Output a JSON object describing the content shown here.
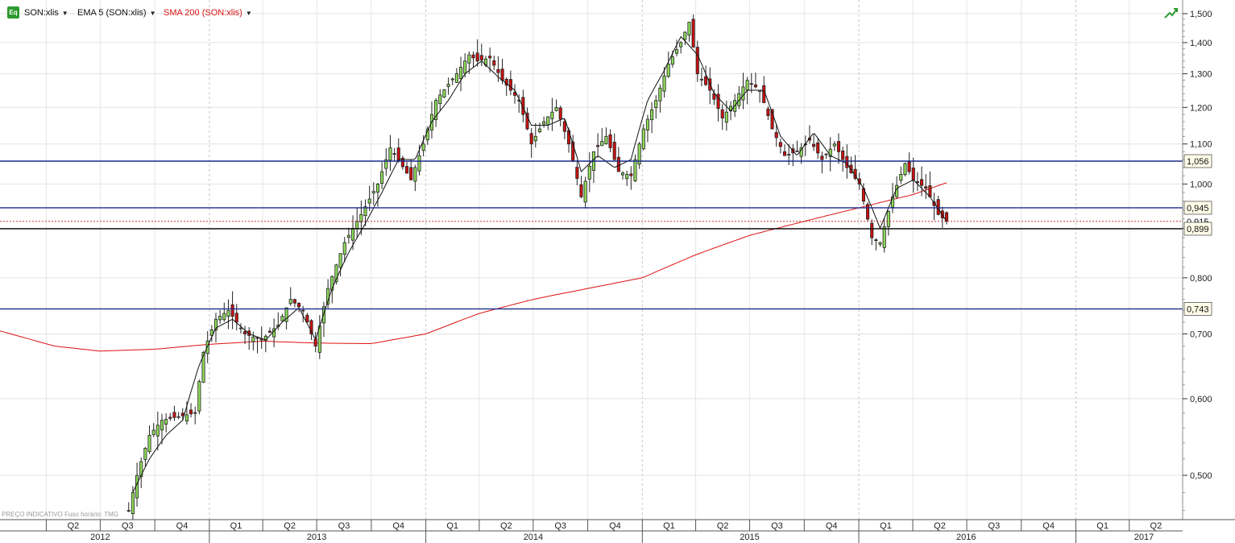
{
  "toolbar": {
    "eq_icon": "Eq",
    "symbol": "SON:xlis",
    "ema_label": "EMA 5 (SON:xlis)",
    "sma_label": "SMA 200 (SON:xlis)",
    "trend_icon": "trend-chart-icon",
    "colors": {
      "ema": "#111111",
      "sma": "#dd1111"
    }
  },
  "watermark": "PREÇO INDICATIVO   Fuso horário: TMG",
  "chart_data": {
    "type": "candlestick",
    "title": "",
    "y_scale": "log",
    "ylim": [
      0.45,
      1.52
    ],
    "y_ticks": [
      {
        "value": 1.5,
        "label": "1,500"
      },
      {
        "value": 1.4,
        "label": "1,400"
      },
      {
        "value": 1.3,
        "label": "1,300"
      },
      {
        "value": 1.2,
        "label": "1,200"
      },
      {
        "value": 1.1,
        "label": "1,100"
      },
      {
        "value": 1.0,
        "label": "1,000"
      },
      {
        "value": 0.9,
        "label": "0,900"
      },
      {
        "value": 0.8,
        "label": "0,800"
      },
      {
        "value": 0.7,
        "label": "0,700"
      },
      {
        "value": 0.6,
        "label": "0,600"
      },
      {
        "value": 0.5,
        "label": "0,500"
      }
    ],
    "horizontal_lines": [
      {
        "value": 1.056,
        "label": "1,056",
        "color": "#1a2a8a"
      },
      {
        "value": 0.945,
        "label": "0,945",
        "color": "#1a2a8a"
      },
      {
        "value": 0.915,
        "label": "0,915",
        "color": "#cc3333"
      },
      {
        "value": 0.899,
        "label": "0,899",
        "color": "#000000"
      },
      {
        "value": 0.743,
        "label": "0,743",
        "color": "#1a2a8a"
      }
    ],
    "quarters": [
      {
        "label": "Q2",
        "start": "2012-04-01"
      },
      {
        "label": "Q3",
        "start": "2012-07-01"
      },
      {
        "label": "Q4",
        "start": "2012-10-01"
      },
      {
        "label": "Q1",
        "start": "2013-01-01"
      },
      {
        "label": "Q2",
        "start": "2013-04-01"
      },
      {
        "label": "Q3",
        "start": "2013-07-01"
      },
      {
        "label": "Q4",
        "start": "2013-10-01"
      },
      {
        "label": "Q1",
        "start": "2014-01-01"
      },
      {
        "label": "Q2",
        "start": "2014-04-01"
      },
      {
        "label": "Q3",
        "start": "2014-07-01"
      },
      {
        "label": "Q4",
        "start": "2014-10-01"
      },
      {
        "label": "Q1",
        "start": "2015-01-01"
      },
      {
        "label": "Q2",
        "start": "2015-04-01"
      },
      {
        "label": "Q3",
        "start": "2015-07-01"
      },
      {
        "label": "Q4",
        "start": "2015-10-01"
      },
      {
        "label": "Q1",
        "start": "2016-01-01"
      },
      {
        "label": "Q2",
        "start": "2016-04-01"
      },
      {
        "label": "Q3",
        "start": "2016-07-01"
      },
      {
        "label": "Q4",
        "start": "2016-10-01"
      },
      {
        "label": "Q1",
        "start": "2017-01-01"
      },
      {
        "label": "Q2",
        "start": "2017-04-01"
      }
    ],
    "years": [
      {
        "label": "2012",
        "start": "2012-01-01"
      },
      {
        "label": "2013",
        "start": "2013-01-01"
      },
      {
        "label": "2014",
        "start": "2014-01-01"
      },
      {
        "label": "2015",
        "start": "2015-01-01"
      },
      {
        "label": "2016",
        "start": "2016-01-01"
      },
      {
        "label": "2017",
        "start": "2017-01-01"
      }
    ],
    "x_range": [
      "2012-01-14",
      "2017-06-30"
    ],
    "ema_key_points": [
      [
        "2012-08-25",
        0.48
      ],
      [
        "2012-09-22",
        0.52
      ],
      [
        "2012-10-20",
        0.55
      ],
      [
        "2012-11-17",
        0.57
      ],
      [
        "2012-12-15",
        0.65
      ],
      [
        "2013-01-12",
        0.71
      ],
      [
        "2013-02-09",
        0.725
      ],
      [
        "2013-03-09",
        0.7
      ],
      [
        "2013-04-06",
        0.69
      ],
      [
        "2013-05-04",
        0.72
      ],
      [
        "2013-06-01",
        0.745
      ],
      [
        "2013-06-29",
        0.69
      ],
      [
        "2013-07-27",
        0.78
      ],
      [
        "2013-08-24",
        0.85
      ],
      [
        "2013-09-21",
        0.91
      ],
      [
        "2013-10-19",
        0.98
      ],
      [
        "2013-11-16",
        1.06
      ],
      [
        "2013-12-14",
        1.06
      ],
      [
        "2014-01-11",
        1.16
      ],
      [
        "2014-02-08",
        1.22
      ],
      [
        "2014-03-08",
        1.3
      ],
      [
        "2014-04-05",
        1.34
      ],
      [
        "2014-05-03",
        1.29
      ],
      [
        "2014-05-31",
        1.25
      ],
      [
        "2014-06-28",
        1.15
      ],
      [
        "2014-07-26",
        1.15
      ],
      [
        "2014-08-23",
        1.17
      ],
      [
        "2014-09-20",
        1.03
      ],
      [
        "2014-10-18",
        1.07
      ],
      [
        "2014-11-15",
        1.04
      ],
      [
        "2014-12-13",
        1.06
      ],
      [
        "2015-01-10",
        1.22
      ],
      [
        "2015-02-07",
        1.31
      ],
      [
        "2015-03-07",
        1.42
      ],
      [
        "2015-04-04",
        1.36
      ],
      [
        "2015-05-02",
        1.24
      ],
      [
        "2015-05-30",
        1.19
      ],
      [
        "2015-06-27",
        1.25
      ],
      [
        "2015-07-25",
        1.25
      ],
      [
        "2015-08-22",
        1.12
      ],
      [
        "2015-09-19",
        1.07
      ],
      [
        "2015-10-17",
        1.13
      ],
      [
        "2015-11-14",
        1.07
      ],
      [
        "2015-12-12",
        1.05
      ],
      [
        "2016-01-09",
        0.99
      ],
      [
        "2016-02-06",
        0.9
      ],
      [
        "2016-03-05",
        0.99
      ],
      [
        "2016-04-02",
        1.01
      ],
      [
        "2016-04-30",
        0.97
      ],
      [
        "2016-05-28",
        0.915
      ]
    ],
    "sma_key_points": [
      [
        "2012-01-14",
        0.705
      ],
      [
        "2012-04-15",
        0.68
      ],
      [
        "2012-07-01",
        0.672
      ],
      [
        "2012-10-01",
        0.675
      ],
      [
        "2013-01-01",
        0.683
      ],
      [
        "2013-04-01",
        0.688
      ],
      [
        "2013-07-01",
        0.685
      ],
      [
        "2013-10-01",
        0.684
      ],
      [
        "2014-01-01",
        0.7
      ],
      [
        "2014-04-01",
        0.735
      ],
      [
        "2014-07-01",
        0.76
      ],
      [
        "2014-10-01",
        0.78
      ],
      [
        "2015-01-01",
        0.8
      ],
      [
        "2015-04-01",
        0.845
      ],
      [
        "2015-07-01",
        0.885
      ],
      [
        "2015-10-01",
        0.915
      ],
      [
        "2016-01-01",
        0.945
      ],
      [
        "2016-04-01",
        0.975
      ],
      [
        "2016-06-01",
        1.005
      ]
    ],
    "price_key_points": [
      [
        "2012-08-18",
        0.46
      ],
      [
        "2012-09-01",
        0.5
      ],
      [
        "2012-09-22",
        0.55
      ],
      [
        "2012-10-13",
        0.57
      ],
      [
        "2012-11-10",
        0.575
      ],
      [
        "2012-12-08",
        0.58
      ],
      [
        "2012-12-22",
        0.67
      ],
      [
        "2013-01-12",
        0.725
      ],
      [
        "2013-02-02",
        0.74
      ],
      [
        "2013-03-02",
        0.7
      ],
      [
        "2013-03-30",
        0.69
      ],
      [
        "2013-04-27",
        0.715
      ],
      [
        "2013-05-18",
        0.76
      ],
      [
        "2013-06-08",
        0.74
      ],
      [
        "2013-06-29",
        0.68
      ],
      [
        "2013-07-20",
        0.78
      ],
      [
        "2013-08-17",
        0.87
      ],
      [
        "2013-09-14",
        0.93
      ],
      [
        "2013-10-12",
        1.0
      ],
      [
        "2013-11-02",
        1.09
      ],
      [
        "2013-12-07",
        1.01
      ],
      [
        "2013-12-28",
        1.1
      ],
      [
        "2014-01-18",
        1.22
      ],
      [
        "2014-02-22",
        1.3
      ],
      [
        "2014-03-15",
        1.36
      ],
      [
        "2014-03-29",
        1.34
      ],
      [
        "2014-04-19",
        1.35
      ],
      [
        "2014-05-10",
        1.28
      ],
      [
        "2014-06-07",
        1.22
      ],
      [
        "2014-06-28",
        1.1
      ],
      [
        "2014-07-19",
        1.16
      ],
      [
        "2014-08-09",
        1.2
      ],
      [
        "2014-08-30",
        1.1
      ],
      [
        "2014-09-20",
        0.97
      ],
      [
        "2014-10-11",
        1.08
      ],
      [
        "2014-11-01",
        1.12
      ],
      [
        "2014-11-22",
        1.03
      ],
      [
        "2014-12-13",
        1.02
      ],
      [
        "2015-01-03",
        1.14
      ],
      [
        "2015-01-24",
        1.22
      ],
      [
        "2015-02-14",
        1.33
      ],
      [
        "2015-03-07",
        1.4
      ],
      [
        "2015-03-21",
        1.47
      ],
      [
        "2015-04-04",
        1.3
      ],
      [
        "2015-04-25",
        1.25
      ],
      [
        "2015-05-16",
        1.17
      ],
      [
        "2015-06-06",
        1.22
      ],
      [
        "2015-06-27",
        1.28
      ],
      [
        "2015-07-18",
        1.25
      ],
      [
        "2015-08-08",
        1.14
      ],
      [
        "2015-08-29",
        1.07
      ],
      [
        "2015-09-19",
        1.08
      ],
      [
        "2015-10-10",
        1.11
      ],
      [
        "2015-10-31",
        1.06
      ],
      [
        "2015-11-21",
        1.1
      ],
      [
        "2015-12-12",
        1.04
      ],
      [
        "2016-01-02",
        1.0
      ],
      [
        "2016-01-23",
        0.88
      ],
      [
        "2016-02-06",
        0.87
      ],
      [
        "2016-02-27",
        0.97
      ],
      [
        "2016-03-19",
        1.05
      ],
      [
        "2016-04-02",
        1.01
      ],
      [
        "2016-04-23",
        0.99
      ],
      [
        "2016-05-14",
        0.93
      ],
      [
        "2016-05-28",
        0.915
      ]
    ]
  }
}
